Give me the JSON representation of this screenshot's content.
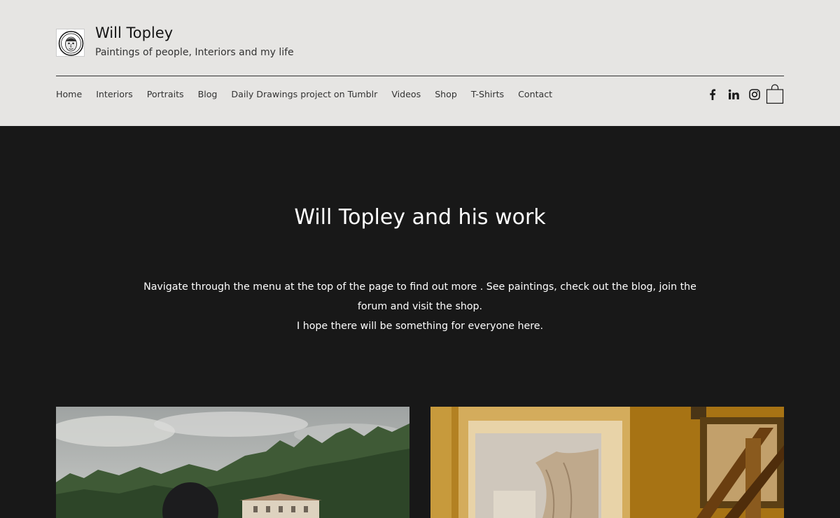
{
  "site": {
    "title": "Will Topley",
    "tagline": "Paintings of people, Interiors and my life"
  },
  "nav": {
    "items": [
      {
        "label": "Home",
        "name": "nav-home"
      },
      {
        "label": "Interiors",
        "name": "nav-interiors"
      },
      {
        "label": "Portraits",
        "name": "nav-portraits"
      },
      {
        "label": "Blog",
        "name": "nav-blog"
      },
      {
        "label": "Daily Drawings project on Tumblr",
        "name": "nav-daily-drawings"
      },
      {
        "label": "Videos",
        "name": "nav-videos"
      },
      {
        "label": "Shop",
        "name": "nav-shop"
      },
      {
        "label": "T-Shirts",
        "name": "nav-t-shirts"
      },
      {
        "label": "Contact",
        "name": "nav-contact"
      }
    ]
  },
  "social": {
    "icons": [
      "facebook-icon",
      "linkedin-icon",
      "instagram-icon"
    ],
    "cart_icon": "shopping-bag-icon"
  },
  "hero": {
    "title": "Will Topley and his work",
    "line1": "Navigate through the menu at the top of the page to find out more . See paintings, check out the blog, join the",
    "line2": "forum and visit the shop.",
    "line3": "I hope there will be something for everyone here."
  },
  "colors": {
    "header_bg": "#e6e5e3",
    "hero_bg": "#181818",
    "text_dark": "#151515",
    "text_light": "#ffffff"
  }
}
